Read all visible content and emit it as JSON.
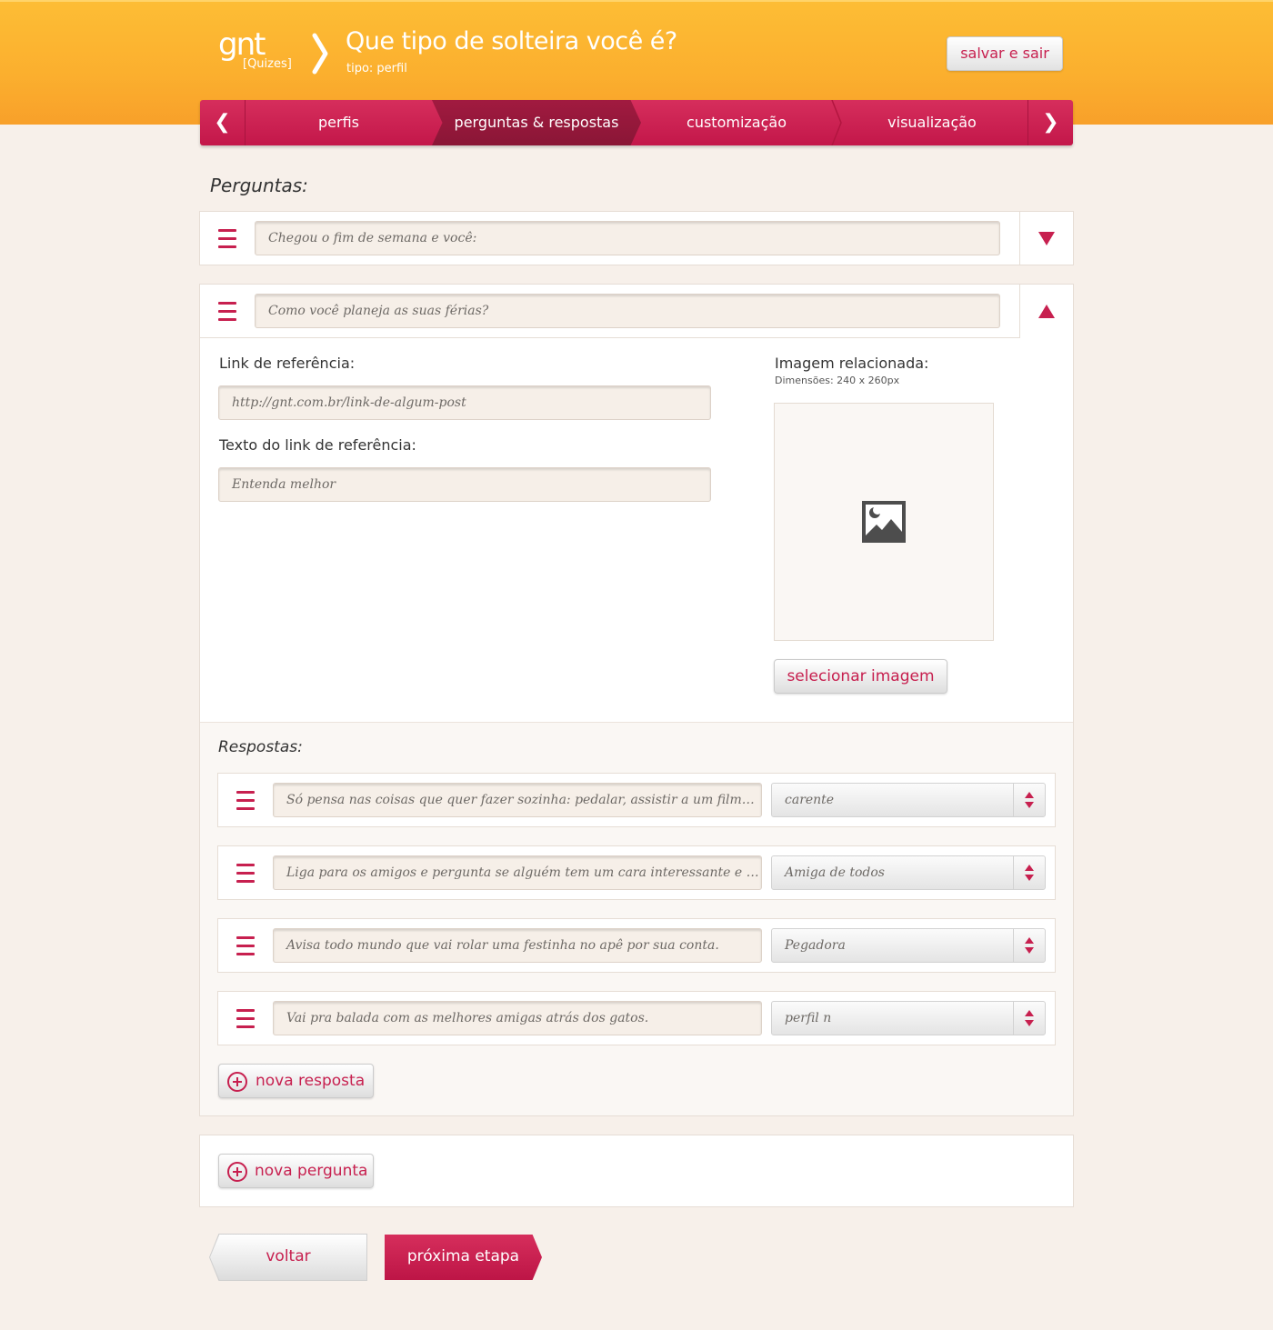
{
  "header": {
    "logo": "gnt",
    "logo_sub": "[Quizes]",
    "title": "Que tipo de solteira você é?",
    "type": "tipo: perfil",
    "save_label": "salvar e sair"
  },
  "nav": {
    "prev": "❮",
    "next": "❯",
    "tabs": [
      {
        "label": "perfis"
      },
      {
        "label": "perguntas & respostas"
      },
      {
        "label": "customização"
      },
      {
        "label": "visualização"
      }
    ]
  },
  "questions_heading": "Perguntas:",
  "questions": [
    {
      "text": "Chegou o fim de semana e você:"
    },
    {
      "text": "Como você planeja as suas férias?"
    }
  ],
  "detail": {
    "link_label": "Link de referência:",
    "link_placeholder": "http://gnt.com.br/link-de-algum-post",
    "link_text_label": "Texto do link de referência:",
    "link_text_placeholder": "Entenda melhor",
    "image_label": "Imagem relacionada:",
    "image_dims": "Dimensões: 240 x 260px",
    "select_image_label": "selecionar imagem"
  },
  "answers_heading": "Respostas:",
  "answers": [
    {
      "text": "Só pensa nas coisas que quer fazer sozinha: pedalar, assistir a um filme, cuidar de si",
      "profile": "carente"
    },
    {
      "text": "Liga para os amigos e pergunta se alguém tem um cara interessante e bonito para apresentar",
      "profile": "Amiga de todos"
    },
    {
      "text": "Avisa todo mundo que vai rolar uma festinha no apê por sua conta.",
      "profile": "Pegadora"
    },
    {
      "text": "Vai pra balada com as melhores amigas atrás dos gatos.",
      "profile": "perfil n"
    }
  ],
  "new_answer_label": "nova resposta",
  "new_question_label": "nova pergunta",
  "back_label": "voltar",
  "next_step_label": "próxima etapa",
  "colors": {
    "accent": "#c7204f",
    "header_orange": "#fbaf2e",
    "background": "#f7f0ea"
  }
}
